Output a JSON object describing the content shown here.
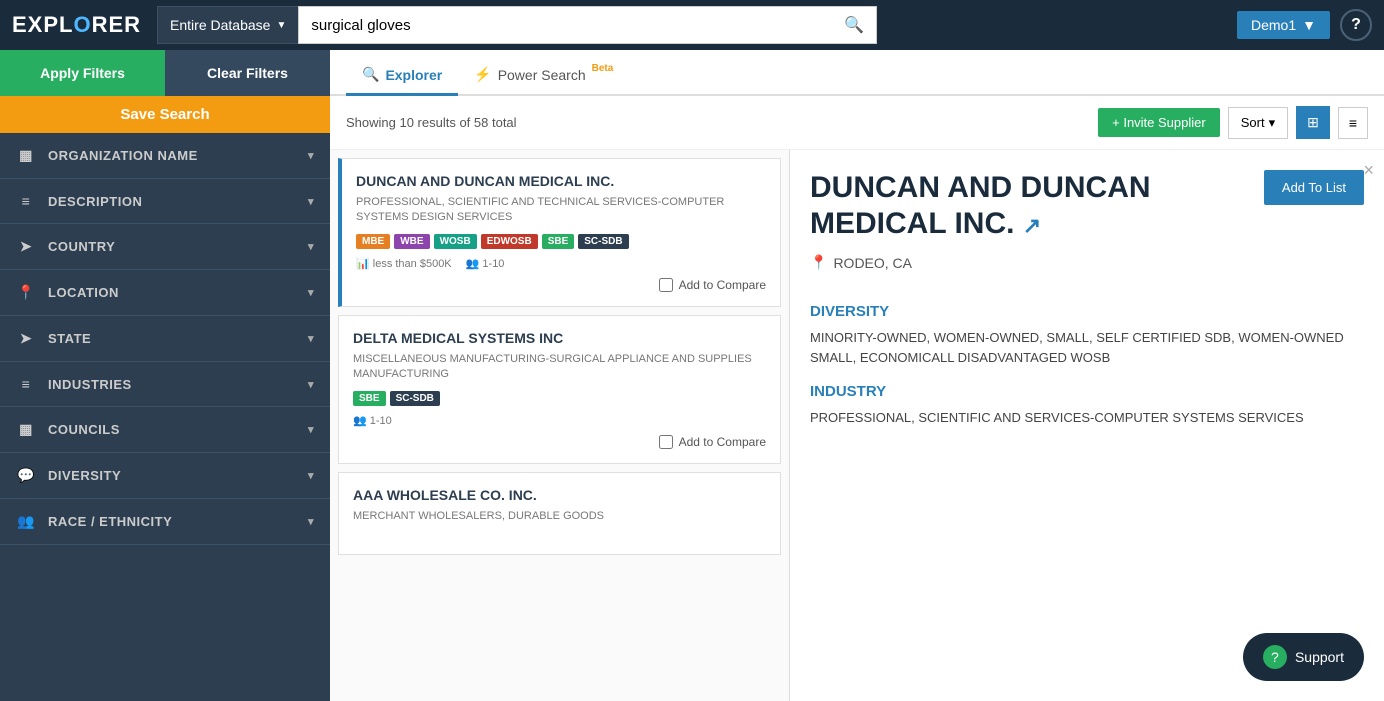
{
  "app": {
    "logo": "EXPL",
    "logo_o": "O",
    "logo_rest": "RER"
  },
  "topnav": {
    "db_select_label": "Entire Database",
    "search_value": "surgical gloves",
    "user_label": "Demo1",
    "help_label": "?"
  },
  "tabs": [
    {
      "id": "explorer",
      "label": "Explorer",
      "active": true,
      "icon": "🔍",
      "beta": ""
    },
    {
      "id": "power",
      "label": "Power Search",
      "active": false,
      "icon": "⚡",
      "beta": "Beta"
    }
  ],
  "results_header": {
    "count_text": "Showing 10 results of 58 total",
    "invite_label": "+ Invite Supplier",
    "sort_label": "Sort",
    "sort_arrow": "▾"
  },
  "sidebar": {
    "apply_label": "Apply Filters",
    "clear_label": "Clear Filters",
    "save_label": "Save Search",
    "filters": [
      {
        "id": "org-name",
        "icon": "▦",
        "label": "ORGANIZATION NAME"
      },
      {
        "id": "description",
        "icon": "≡",
        "label": "DESCRIPTION"
      },
      {
        "id": "country",
        "icon": "➤",
        "label": "COUNTRY"
      },
      {
        "id": "location",
        "icon": "📍",
        "label": "LOCATION"
      },
      {
        "id": "state",
        "icon": "➤",
        "label": "STATE"
      },
      {
        "id": "industries",
        "icon": "≡",
        "label": "INDUSTRIES"
      },
      {
        "id": "councils",
        "icon": "▦",
        "label": "COUNCILS"
      },
      {
        "id": "diversity",
        "icon": "💬",
        "label": "DIVERSITY"
      },
      {
        "id": "race-ethnicity",
        "icon": "👥",
        "label": "RACE / ETHNICITY"
      }
    ]
  },
  "results": [
    {
      "id": "result-1",
      "title": "DUNCAN AND DUNCAN MEDICAL INC.",
      "description": "PROFESSIONAL, SCIENTIFIC AND TECHNICAL SERVICES-COMPUTER SYSTEMS DESIGN SERVICES",
      "badges": [
        "MBE",
        "WBE",
        "WOSB",
        "EDWOSB",
        "SBE",
        "SC-SDB"
      ],
      "revenue": "less than $500K",
      "employees": "1-10",
      "selected": true
    },
    {
      "id": "result-2",
      "title": "DELTA MEDICAL SYSTEMS INC",
      "description": "MISCELLANEOUS MANUFACTURING-SURGICAL APPLIANCE AND SUPPLIES MANUFACTURING",
      "badges": [
        "SBE",
        "SC-SDB"
      ],
      "revenue": "",
      "employees": "1-10",
      "selected": false
    },
    {
      "id": "result-3",
      "title": "AAA WHOLESALE CO. INC.",
      "description": "MERCHANT WHOLESALERS, DURABLE GOODS",
      "badges": [],
      "revenue": "",
      "employees": "",
      "selected": false
    }
  ],
  "detail": {
    "title": "DUNCAN AND DUNCAN MEDICAL INC.",
    "ext_link": "↗",
    "location_icon": "📍",
    "location": "RODEO, CA",
    "add_to_list": "Add To List",
    "close": "×",
    "diversity_title": "DIVERSITY",
    "diversity_text": "MINORITY-OWNED, WOMEN-OWNED, SMALL, SELF CERTIFIED SDB, WOMEN-OWNED SMALL, ECONOMICALL DISADVANTAGED WOSB",
    "industry_title": "INDUSTRY",
    "industry_text": "PROFESSIONAL, SCIENTIFIC AND SERVICES-COMPUTER SYSTEMS SERVICES"
  },
  "support": {
    "label": "Support",
    "icon": "?"
  },
  "badge_colors": {
    "MBE": "badge-mbe",
    "WBE": "badge-wbe",
    "WOSB": "badge-wosb",
    "EDWOSB": "badge-edwosb",
    "SBE": "badge-sbe",
    "SC-SDB": "badge-sc-sdb"
  }
}
